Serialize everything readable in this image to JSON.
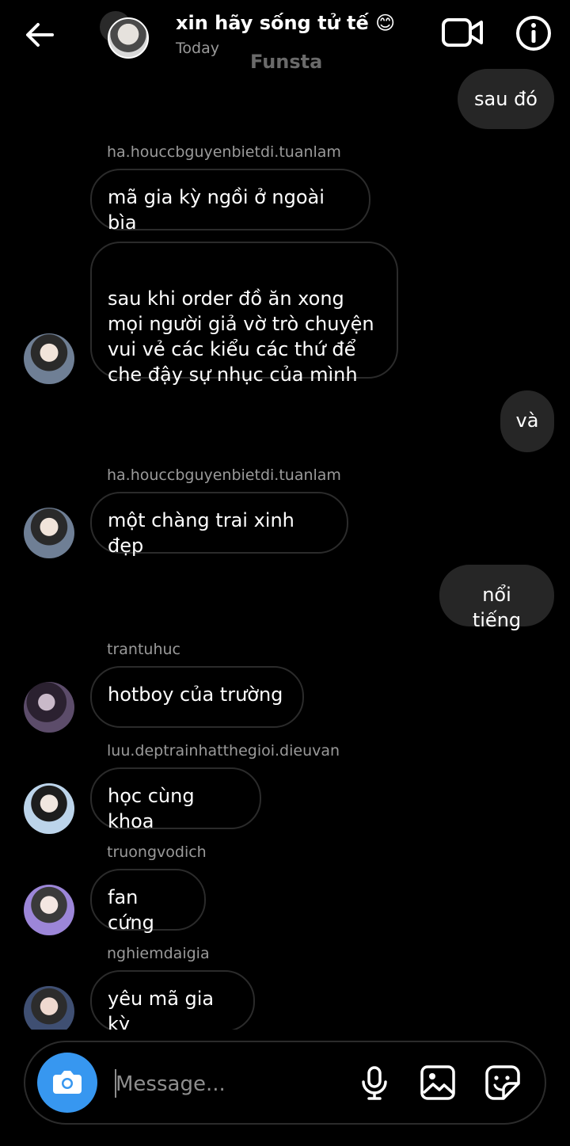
{
  "header": {
    "title": "xin hãy sống tử tế 😊",
    "subtitle": "Today",
    "overlay_label": "Funsta",
    "icons": [
      "back-arrow-icon",
      "video-call-icon",
      "info-icon"
    ]
  },
  "messages": [
    {
      "type": "out",
      "text": "sau đó"
    },
    {
      "type": "in",
      "sender": "ha.houccbguyenbietdi.tuanlam",
      "text": "mã gia kỳ ngồi ở ngoài bìa"
    },
    {
      "type": "in",
      "text": "sau khi order đồ ăn xong\nmọi người giả vờ trò chuyện\nvui vẻ các kiểu các thứ để\nche đậy sự nhục của mình"
    },
    {
      "type": "out",
      "text": "và"
    },
    {
      "type": "in",
      "sender": "ha.houccbguyenbietdi.tuanlam",
      "text": "một chàng trai xinh đẹp"
    },
    {
      "type": "out",
      "text": "nổi tiếng"
    },
    {
      "type": "in",
      "sender": "trantuhuc",
      "text": "hotboy của trường"
    },
    {
      "type": "in",
      "sender": "luu.deptrainhatthegioi.dieuvan",
      "text": "học cùng khoa"
    },
    {
      "type": "in",
      "sender": "truongvodich",
      "text": "fan cứng"
    },
    {
      "type": "in",
      "sender": "nghiemdaigia",
      "text": "yêu mã gia kỳ"
    }
  ],
  "composer": {
    "placeholder": "Message...",
    "icons": [
      "camera-icon",
      "microphone-icon",
      "gallery-icon",
      "sticker-icon"
    ],
    "accent": "#3797f0"
  }
}
